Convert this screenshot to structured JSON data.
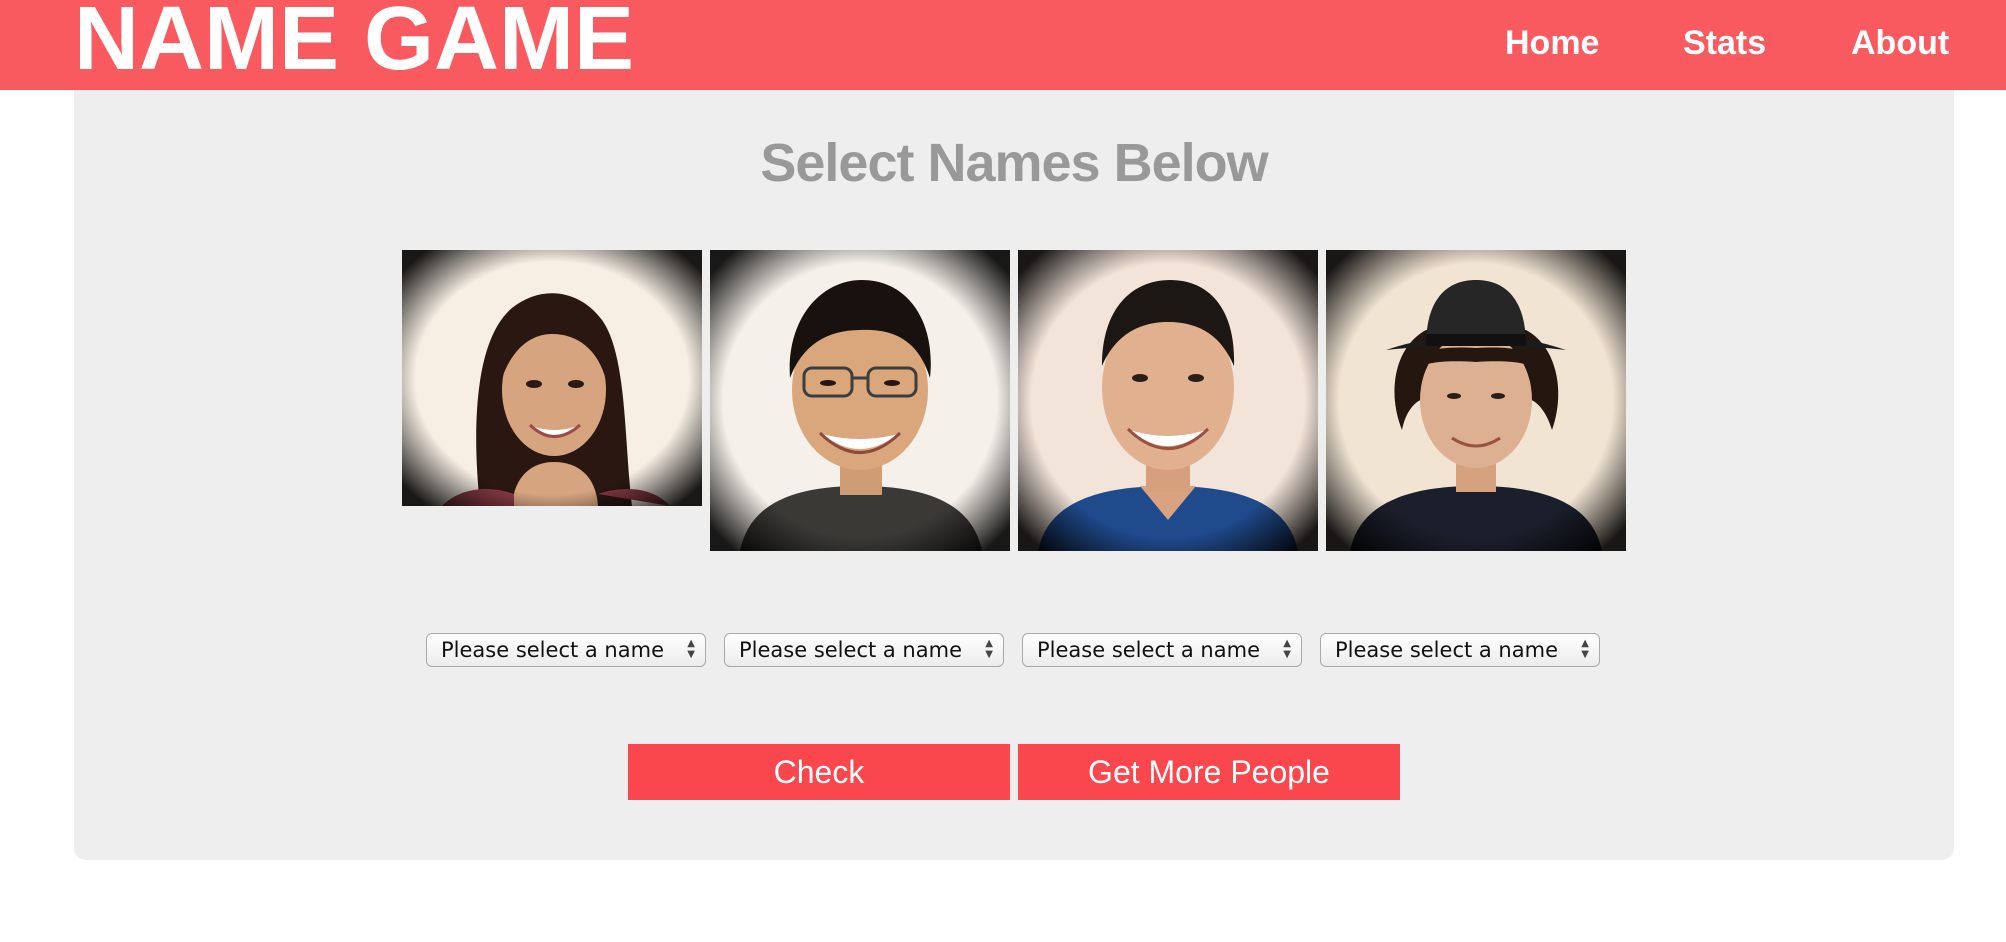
{
  "header": {
    "brand": "NAME GAME",
    "nav": [
      "Home",
      "Stats",
      "About"
    ]
  },
  "main": {
    "heading": "Select Names Below",
    "photos": [
      {
        "icon": "person-photo-1"
      },
      {
        "icon": "person-photo-2"
      },
      {
        "icon": "person-photo-3"
      },
      {
        "icon": "person-photo-4"
      }
    ],
    "selects": [
      {
        "value": "Please select a name"
      },
      {
        "value": "Please select a name"
      },
      {
        "value": "Please select a name"
      },
      {
        "value": "Please select a name"
      }
    ],
    "buttons": {
      "check": "Check",
      "more": "Get More People"
    }
  },
  "colors": {
    "header_bg": "#f95a5f",
    "panel_bg": "#eeeeee",
    "button_bg": "#f9474d",
    "heading_text": "#999999"
  }
}
